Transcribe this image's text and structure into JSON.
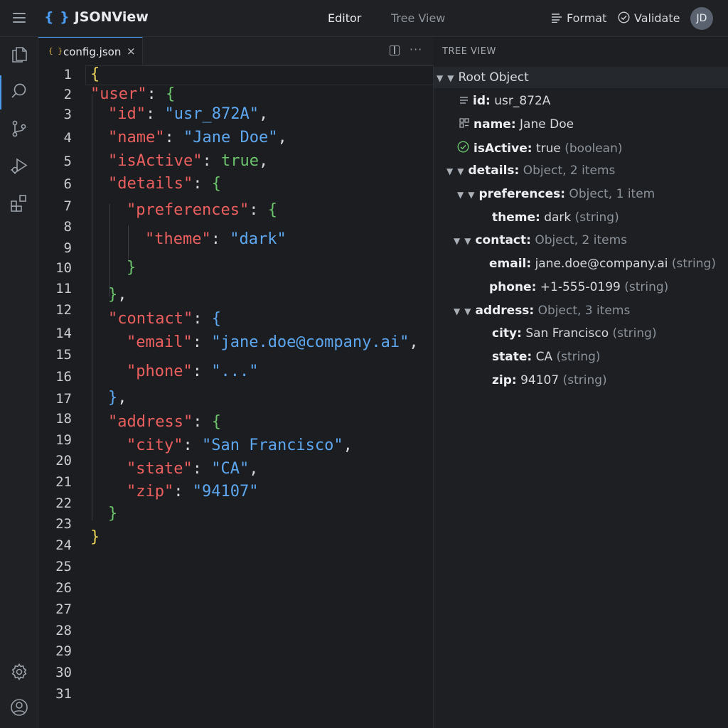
{
  "app": {
    "logo_braces": "{ }",
    "name": "JSONView",
    "nav": {
      "editor": "Editor",
      "tree_view": "Tree View"
    },
    "actions": {
      "format": "Format",
      "validate": "Validate"
    },
    "avatar_initials": "JD"
  },
  "tab": {
    "icon": "{ }",
    "filename": "config.json",
    "close": "×",
    "more": "···"
  },
  "editor": {
    "line_numbers": [
      "1",
      "2",
      "3",
      "4",
      "5",
      "6",
      "7",
      "8",
      "9",
      "10",
      "11",
      "12",
      "14",
      "15",
      "16",
      "17",
      "18",
      "19",
      "20",
      "21",
      "22",
      "23",
      "24",
      "25",
      "26",
      "27",
      "28",
      "29",
      "30",
      "31"
    ],
    "code": {
      "l1_open": "{",
      "l2_key": "\"user\"",
      "l2_punc": ": ",
      "l2_open": "{",
      "l3_key": "\"id\"",
      "l3_punc": ": ",
      "l3_val": "\"usr_872A\"",
      "l3_comma": ",",
      "l4_key": "\"name\"",
      "l4_punc": ": ",
      "l4_val": "\"Jane Doe\"",
      "l4_comma": ",",
      "l5_key": "\"isActive\"",
      "l5_punc": ": ",
      "l5_val": "true",
      "l5_comma": ",",
      "l6_key": "\"details\"",
      "l6_punc": ": ",
      "l6_open": "{",
      "l7_key": "\"preferences\"",
      "l7_punc": ": ",
      "l7_open": "{",
      "l8_key": "\"theme\"",
      "l8_punc": ": ",
      "l8_val": "\"dark\"",
      "l9_close": "}",
      "l10_close": "}",
      "l10_comma": ",",
      "l11_key": "\"contact\"",
      "l11_punc": ": ",
      "l11_open": "{",
      "l12_key": "\"email\"",
      "l12_punc": ": ",
      "l12_val": "\"jane.doe@company.ai\"",
      "l12_comma": ",",
      "l13_key": "\"phone\"",
      "l13_punc": ": ",
      "l13_val": "\"...\"",
      "l14_close": "}",
      "l14_comma": ",",
      "l15_key": "\"address\"",
      "l15_punc": ": ",
      "l15_open": "{",
      "l16_key": "\"city\"",
      "l16_punc": ": ",
      "l16_val": "\"San Francisco\"",
      "l16_comma": ",",
      "l17_key": "\"state\"",
      "l17_punc": ": ",
      "l17_val": "\"CA\"",
      "l17_comma": ",",
      "l18_key": "\"zip\"",
      "l18_punc": ": ",
      "l18_val": "\"94107\"",
      "l19_close": "}",
      "l20_close": "}"
    }
  },
  "tree": {
    "title": "TREE VIEW",
    "root": "Root Object",
    "id": {
      "key": "id:",
      "value": " usr_872A"
    },
    "name": {
      "key": "name:",
      "value": " Jane Doe"
    },
    "isActive": {
      "key": "isActive:",
      "value": " true",
      "type": " (boolean)"
    },
    "details": {
      "key": "details:",
      "type": " Object, 2 items"
    },
    "preferences": {
      "key": "preferences:",
      "type": " Object, 1 item"
    },
    "theme": {
      "key": "theme:",
      "value": " dark",
      "type": " (string)"
    },
    "contact": {
      "key": "contact:",
      "type": " Object, 2 items"
    },
    "email": {
      "key": "email:",
      "value": " jane.doe@company.ai",
      "type": " (string)"
    },
    "phone": {
      "key": "phone:",
      "value": " +1-555-0199",
      "type": " (string)"
    },
    "address": {
      "key": "address:",
      "type": " Object, 3 items"
    },
    "city": {
      "key": "city:",
      "value": " San Francisco",
      "type": " (string)"
    },
    "state": {
      "key": "state:",
      "value": " CA",
      "type": " (string)"
    },
    "zip": {
      "key": "zip:",
      "value": " 94107",
      "type": " (string)"
    }
  },
  "colors": {
    "accent": "#4a9bef",
    "key": "#ec5f5f",
    "string": "#5da7f0",
    "boolean": "#6cc46c",
    "bracket": "#e8d05a"
  },
  "icons": {
    "menu": "hamburger-menu-icon",
    "format": "format-lines-icon",
    "validate": "check-circle-icon",
    "explorer": "files-icon",
    "search": "search-icon",
    "git": "source-control-icon",
    "debug": "run-debug-icon",
    "extensions": "extensions-icon",
    "settings": "gear-icon",
    "account": "account-icon"
  }
}
